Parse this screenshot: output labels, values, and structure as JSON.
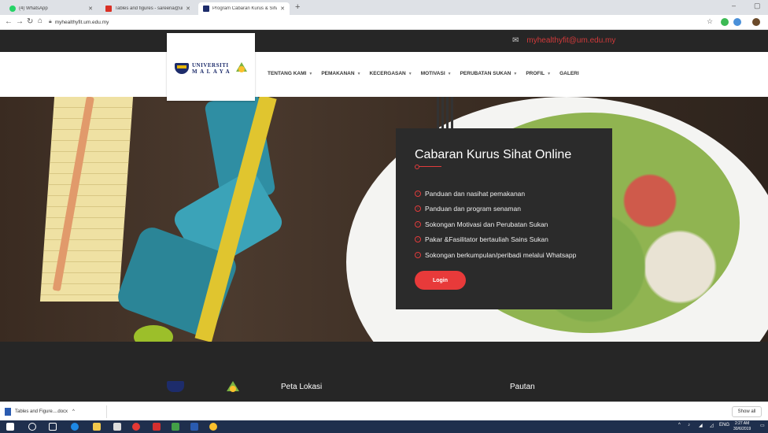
{
  "browser": {
    "tabs": [
      {
        "label": "(4) WhatsApp",
        "icon": "whatsapp-icon",
        "color": "#25d366",
        "active": false
      },
      {
        "label": "Tables and figures - sareena@um",
        "icon": "gmail-icon",
        "color": "#d93025",
        "active": false
      },
      {
        "label": "Program Cabaran Kurus & Sihat",
        "icon": "um-crest-icon",
        "color": "#1d2c6b",
        "active": true
      }
    ],
    "new_tab_symbol": "+",
    "url": "myhealthyfit.um.edu.my"
  },
  "site": {
    "email": "myhealthyfit@um.edu.my",
    "logo": {
      "line1": "UNIVERSITI",
      "line2": "MALAYA"
    },
    "menu": [
      {
        "label": "TENTANG KAMI",
        "dropdown": true
      },
      {
        "label": "PEMAKANAN",
        "dropdown": true
      },
      {
        "label": "KECERGASAN",
        "dropdown": true
      },
      {
        "label": "MOTIVASI",
        "dropdown": true
      },
      {
        "label": "PERUBATAN SUKAN",
        "dropdown": true
      },
      {
        "label": "PROFIL",
        "dropdown": true
      },
      {
        "label": "GALERI",
        "dropdown": false
      }
    ],
    "promo": {
      "title": "Cabaran Kurus Sihat Online",
      "features": [
        "Panduan dan nasihat pemakanan",
        "Panduan dan program senaman",
        "Sokongan Motivasi dan Perubatan Sukan",
        "Pakar &Fasilitator bertauliah Sains Sukan",
        "Sokongan berkumpulan/peribadi melalui Whatsapp"
      ],
      "login_label": "Login"
    },
    "footer": {
      "col1": "Peta Lokasi",
      "col2": "Pautan"
    },
    "colors": {
      "accent": "#e83a3a",
      "dark": "#262626",
      "brand_blue": "#1d2c6b"
    }
  },
  "download_bar": {
    "file": "Tables and Figure....docx",
    "show_all": "Show all"
  },
  "taskbar": {
    "tray_lang": "ENG",
    "time": "2:27 AM",
    "date": "30/6/2019"
  }
}
